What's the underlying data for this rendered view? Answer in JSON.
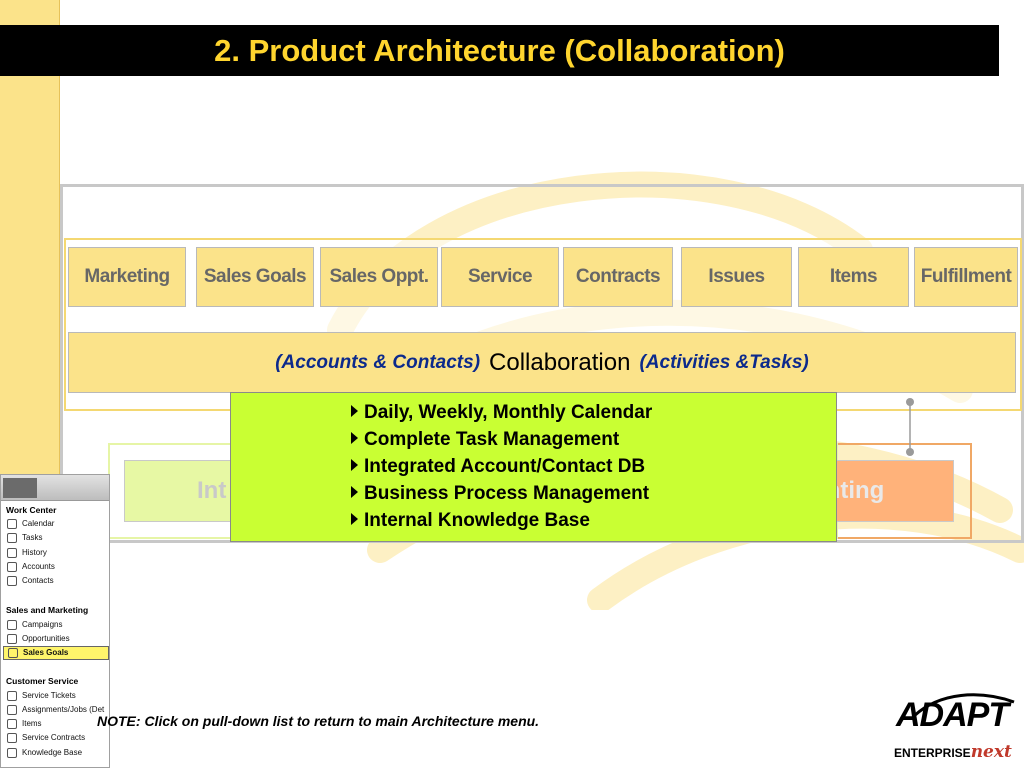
{
  "slide": {
    "title": "2. Product Architecture (Collaboration)"
  },
  "modules": [
    {
      "label": "Marketing"
    },
    {
      "label": "Sales Goals"
    },
    {
      "label": "Sales Oppt."
    },
    {
      "label": "Service"
    },
    {
      "label": "Contracts"
    },
    {
      "label": "Issues"
    },
    {
      "label": "Items"
    },
    {
      "label": "Fulfillment"
    }
  ],
  "collaboration_bar": {
    "left": "(Accounts & Contacts)",
    "center": "Collaboration",
    "right": "(Activities &Tasks)"
  },
  "lower_row": {
    "left_partial": "Int",
    "right_partial": "unting"
  },
  "popup": {
    "items": [
      "Daily, Weekly, Monthly Calendar",
      "Complete Task Management",
      "Integrated Account/Contact DB",
      "Business Process Management",
      "Internal Knowledge Base"
    ]
  },
  "sidebar": {
    "sections": [
      {
        "title": "Work Center",
        "items": [
          "Calendar",
          "Tasks",
          "History",
          "Accounts",
          "Contacts"
        ]
      },
      {
        "title": "Sales and Marketing",
        "items": [
          "Campaigns",
          "Opportunities",
          "Sales Goals"
        ]
      },
      {
        "title": "Customer Service",
        "items": [
          "Service Tickets",
          "Assignments/Jobs (Det",
          "Items",
          "Service Contracts",
          "Knowledge Base"
        ]
      }
    ],
    "selected_item": "Sales Goals"
  },
  "note": "NOTE: Click on pull-down list to return to main Architecture menu.",
  "logo": {
    "word": "ADAPT",
    "tag_prefix": "ENTERPRISE",
    "tag_suffix": "next"
  },
  "colors": {
    "title_bg": "#000000",
    "title_text": "#ffd52e",
    "module_fill": "#fbe38a",
    "popup_fill": "#c9ff33",
    "accent_blue": "#0c2a8c"
  }
}
